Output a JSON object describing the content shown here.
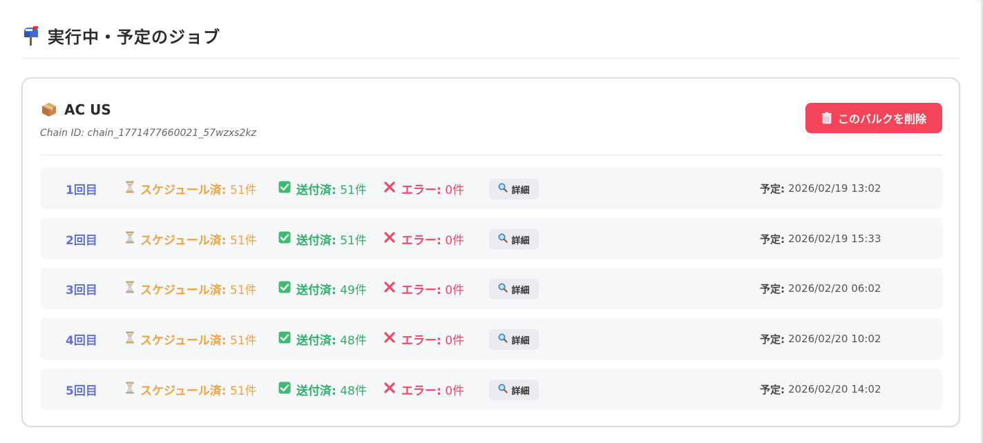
{
  "section": {
    "icon": "mailbox-icon",
    "title": "実行中・予定のジョブ"
  },
  "card": {
    "icon": "package-icon",
    "title": "AC US",
    "chain_id": "Chain ID: chain_1771477660021_57wzxs2kz",
    "delete_button": {
      "icon": "trash-icon",
      "label": "このバルクを削除"
    }
  },
  "labels": {
    "scheduled": "スケジュール済:",
    "sent": "送付済:",
    "error": "エラー:",
    "detail": "詳細",
    "planned": "予定:"
  },
  "runs": [
    {
      "label": "1回目",
      "scheduled": "51件",
      "sent": "51件",
      "error": "0件",
      "planned_at": "2026/02/19 13:02"
    },
    {
      "label": "2回目",
      "scheduled": "51件",
      "sent": "51件",
      "error": "0件",
      "planned_at": "2026/02/19 15:33"
    },
    {
      "label": "3回目",
      "scheduled": "51件",
      "sent": "49件",
      "error": "0件",
      "planned_at": "2026/02/20 06:02"
    },
    {
      "label": "4回目",
      "scheduled": "51件",
      "sent": "48件",
      "error": "0件",
      "planned_at": "2026/02/20 10:02"
    },
    {
      "label": "5回目",
      "scheduled": "51件",
      "sent": "48件",
      "error": "0件",
      "planned_at": "2026/02/20 14:02"
    }
  ],
  "colors": {
    "accent_delete": "#f2455a",
    "run_label": "#6470d0",
    "scheduled": "#f0a33c",
    "sent": "#2fae6b",
    "error": "#ea4a68"
  }
}
